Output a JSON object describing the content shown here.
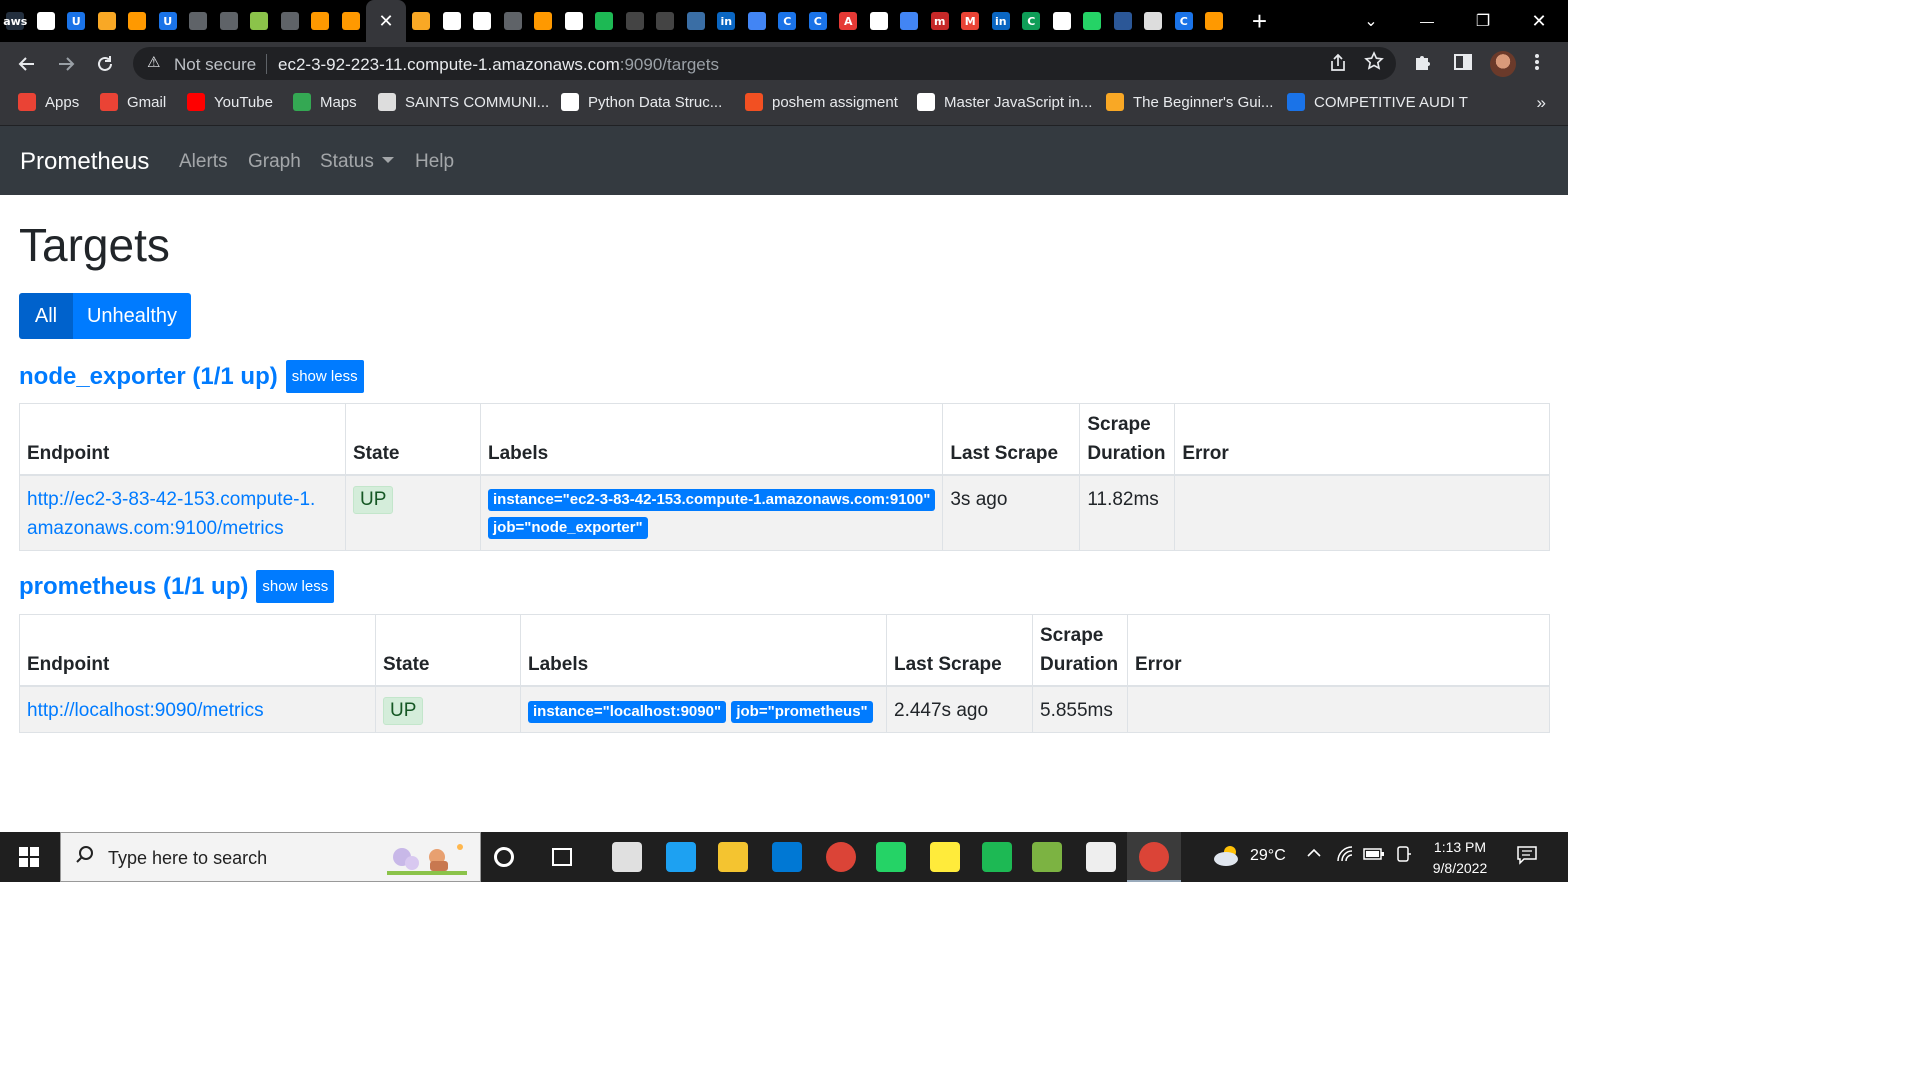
{
  "browser": {
    "tabs": [
      {
        "icon": "aws-icon",
        "label": "aws",
        "color": "#232f3e"
      },
      {
        "icon": "window-icon",
        "label": "",
        "color": "#ffffff"
      },
      {
        "icon": "u-icon",
        "label": "U",
        "color": "#1a73e8"
      },
      {
        "icon": "box-icon",
        "label": "",
        "color": "#f9a825"
      },
      {
        "icon": "cube-icon",
        "label": "",
        "color": "#ff9900"
      },
      {
        "icon": "u-icon",
        "label": "U",
        "color": "#1a73e8"
      },
      {
        "icon": "terminal-icon",
        "label": "",
        "color": "#5f6368"
      },
      {
        "icon": "terminal-icon",
        "label": "",
        "color": "#5f6368"
      },
      {
        "icon": "key-icon",
        "label": "",
        "color": "#8bc34a"
      },
      {
        "icon": "terminal-icon",
        "label": "",
        "color": "#5f6368"
      },
      {
        "icon": "cube-icon",
        "label": "",
        "color": "#ff9900"
      },
      {
        "icon": "cube-icon",
        "label": "",
        "color": "#ff9900"
      }
    ],
    "active_tab_close": "✕",
    "tabs_after": [
      {
        "icon": "box-icon",
        "label": "",
        "color": "#f9a825"
      },
      {
        "icon": "globe-icon",
        "label": "",
        "color": "#ffffff"
      },
      {
        "icon": "globe-icon",
        "label": "",
        "color": "#ffffff"
      },
      {
        "icon": "terminal-icon",
        "label": "",
        "color": "#5f6368"
      },
      {
        "icon": "cube-icon",
        "label": "",
        "color": "#ff9900"
      },
      {
        "icon": "globe-icon",
        "label": "",
        "color": "#ffffff"
      },
      {
        "icon": "refresh-circle-icon",
        "label": "",
        "color": "#1db954"
      },
      {
        "icon": "github-icon",
        "label": "",
        "color": "#444444"
      },
      {
        "icon": "github-icon",
        "label": "",
        "color": "#444444"
      },
      {
        "icon": "circle-logo-icon",
        "label": "",
        "color": "#3a6ea5"
      },
      {
        "icon": "linkedin-icon",
        "label": "in",
        "color": "#0a66c2"
      },
      {
        "icon": "docs-icon",
        "label": "",
        "color": "#4285f4"
      },
      {
        "icon": "c-icon",
        "label": "C",
        "color": "#1a73e8"
      },
      {
        "icon": "c-icon",
        "label": "C",
        "color": "#1a73e8"
      },
      {
        "icon": "a-icon",
        "label": "A",
        "color": "#e53935"
      },
      {
        "icon": "window-icon",
        "label": "",
        "color": "#ffffff"
      },
      {
        "icon": "docs-icon",
        "label": "",
        "color": "#4285f4"
      },
      {
        "icon": "m-icon",
        "label": "m",
        "color": "#c62828"
      },
      {
        "icon": "gmail-icon",
        "label": "M",
        "color": "#ea4335"
      },
      {
        "icon": "linkedin-icon",
        "label": "in",
        "color": "#0a66c2"
      },
      {
        "icon": "c-icon",
        "label": "C",
        "color": "#0f9d58"
      },
      {
        "icon": "chrome-icon",
        "label": "",
        "color": "#ffffff"
      },
      {
        "icon": "whatsapp-icon",
        "label": "",
        "color": "#25d366"
      },
      {
        "icon": "mail-icon",
        "label": "",
        "color": "#2b5797"
      },
      {
        "icon": "saints-icon",
        "label": "",
        "color": "#dddddd"
      },
      {
        "icon": "c-icon",
        "label": "C",
        "color": "#1a73e8"
      },
      {
        "icon": "cube-icon",
        "label": "",
        "color": "#ff9900"
      }
    ],
    "new_tab": "+",
    "window_controls": {
      "dropdown": "⌄",
      "minimize": "—",
      "restore": "❐",
      "close": "✕"
    },
    "address": {
      "warning": "⚠",
      "not_secure": "Not secure",
      "host": "ec2-3-92-223-11.compute-1.amazonaws.com",
      "path": ":9090/targets"
    },
    "bookmarks": [
      {
        "icon": "apps-grid-icon",
        "label": "Apps",
        "color": "#ea4335"
      },
      {
        "icon": "gmail-icon",
        "label": "Gmail",
        "color": "#ea4335"
      },
      {
        "icon": "youtube-icon",
        "label": "YouTube",
        "color": "#ff0000"
      },
      {
        "icon": "maps-icon",
        "label": "Maps",
        "color": "#34a853"
      },
      {
        "icon": "saints-icon",
        "label": "SAINTS COMMUNI...",
        "color": "#dddddd"
      },
      {
        "icon": "wordpress-icon",
        "label": "Python  Data Struc...",
        "color": "#ffffff"
      },
      {
        "icon": "microsoft-icon",
        "label": "poshem assigment",
        "color": "#f25022"
      },
      {
        "icon": "wordpress-icon",
        "label": "Master JavaScript in...",
        "color": "#ffffff"
      },
      {
        "icon": "handshake-icon",
        "label": "The Beginner's Gui...",
        "color": "#f9a825"
      },
      {
        "icon": "c-icon",
        "label": "COMPETITIVE AUDI T",
        "color": "#1a73e8"
      }
    ],
    "bookmarks_more": "»"
  },
  "app": {
    "brand": "Prometheus",
    "nav": [
      "Alerts",
      "Graph",
      "Status",
      "Help"
    ]
  },
  "page": {
    "title": "Targets",
    "filters": {
      "all": "All",
      "unhealthy": "Unhealthy"
    },
    "columns": {
      "endpoint": "Endpoint",
      "state": "State",
      "labels": "Labels",
      "last_scrape": "Last Scrape",
      "scrape_duration_1": "Scrape",
      "scrape_duration_2": "Duration",
      "error": "Error"
    },
    "pools": [
      {
        "heading": "node_exporter (1/1 up)",
        "toggle": "show less",
        "rows": [
          {
            "endpoint_line1": "http://ec2-3-83-42-153.compute-1.",
            "endpoint_line2": "amazonaws.com:9100/metrics",
            "state": "UP",
            "labels": [
              "instance=\"ec2-3-83-42-153.compute-1.amazonaws.com:9100\"",
              "job=\"node_exporter\""
            ],
            "last_scrape": "3s ago",
            "scrape_duration": "11.82ms",
            "error": ""
          }
        ]
      },
      {
        "heading": "prometheus (1/1 up)",
        "toggle": "show less",
        "rows": [
          {
            "endpoint": "http://localhost:9090/metrics",
            "state": "UP",
            "labels": [
              "instance=\"localhost:9090\"",
              "job=\"prometheus\""
            ],
            "last_scrape": "2.447s ago",
            "scrape_duration": "5.855ms",
            "error": ""
          }
        ]
      }
    ]
  },
  "taskbar": {
    "search_placeholder": "Type here to search",
    "weather": "29°C",
    "time": "1:13 PM",
    "date": "9/8/2022",
    "apps": [
      "cortana-icon",
      "task-view-icon",
      "mail-icon",
      "twitter-icon",
      "file-explorer-icon",
      "vscode-icon",
      "chrome-icon",
      "whatsapp-icon",
      "sticky-notes-icon",
      "spotify-icon",
      "image-editor-icon",
      "photos-icon",
      "chrome-icon"
    ]
  },
  "colors": {
    "navbar": "#343a40",
    "primary": "#007bff",
    "primary_active": "#0062cc",
    "state_up_bg": "#d4edda",
    "state_up_text": "#155724",
    "row_bg": "#f2f2f2"
  }
}
